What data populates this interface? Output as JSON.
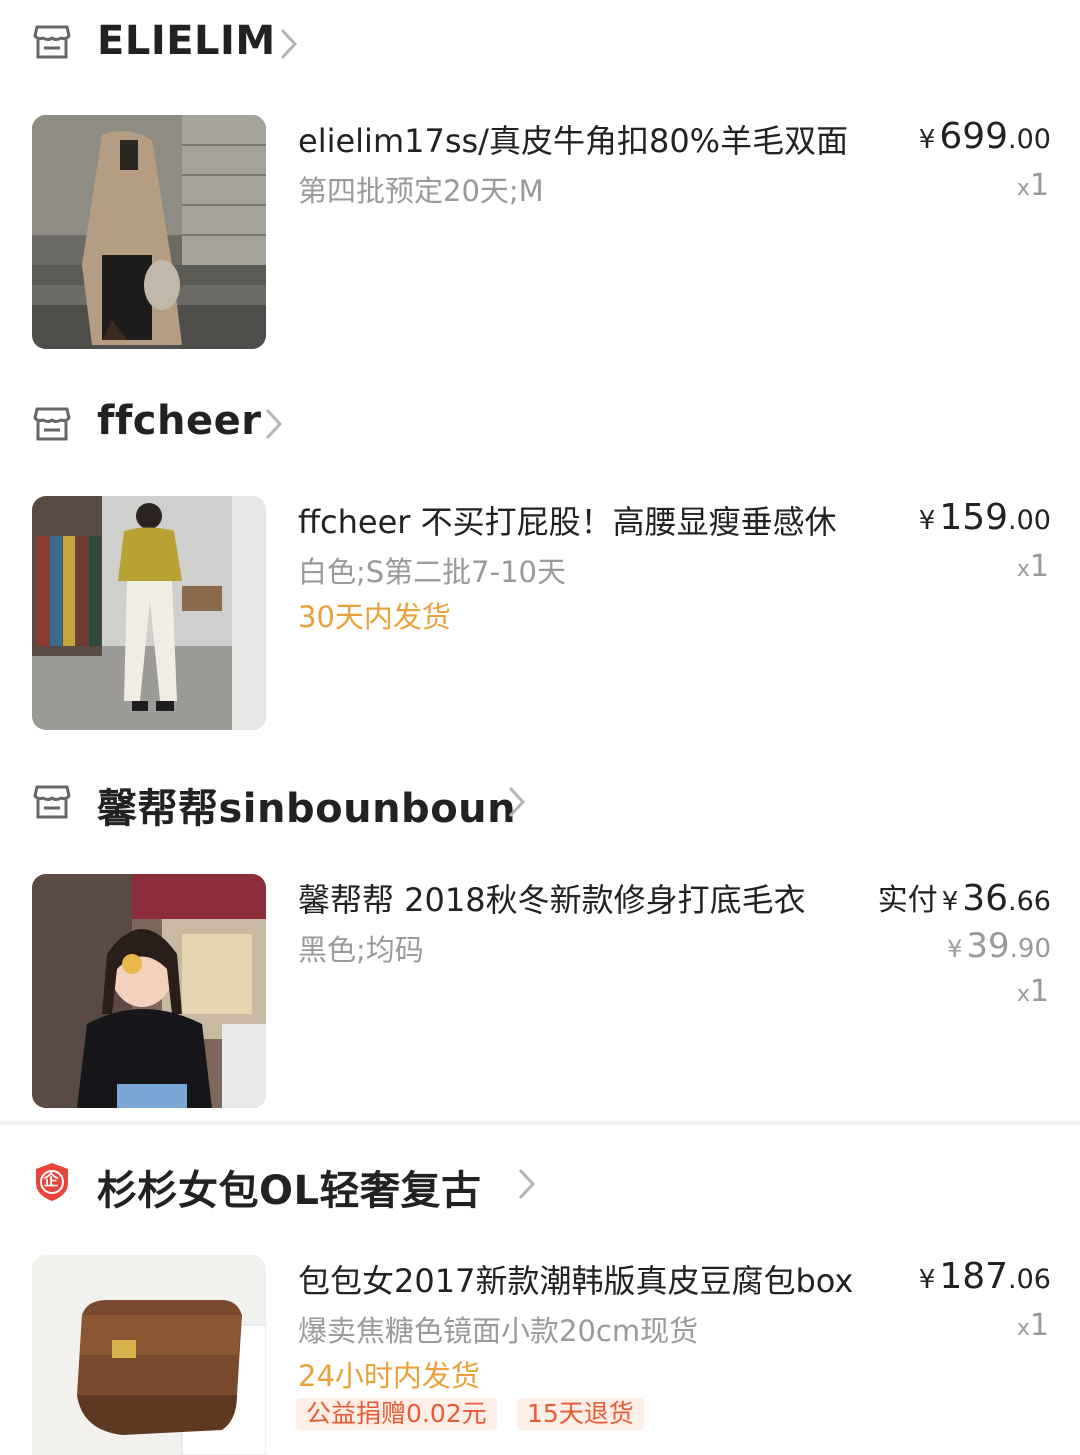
{
  "stores": [
    {
      "name": "ELIELIM",
      "icon": "store-icon",
      "item": {
        "title": "elielim17ss/真皮牛角扣80%羊毛双面",
        "sku": "第四批预定20天;M",
        "currency": "¥",
        "price_int": "699",
        "price_dec": ".00",
        "qty_x": "x",
        "qty": "1"
      }
    },
    {
      "name": "ffcheer",
      "icon": "store-icon",
      "item": {
        "title": "ffcheer 不买打屁股！高腰显瘦垂感休",
        "sku": "白色;S第二批7-10天",
        "ship": "30天内发货",
        "currency": "¥",
        "price_int": "159",
        "price_dec": ".00",
        "qty_x": "x",
        "qty": "1"
      }
    },
    {
      "name": "馨帮帮sinbounboun",
      "icon": "store-icon",
      "item": {
        "title": "馨帮帮 2018秋冬新款修身打底毛衣",
        "sku": "黑色;均码",
        "paid_label": "实付",
        "currency": "¥",
        "price_int": "36",
        "price_dec": ".66",
        "orig_currency": "¥",
        "orig_int": "39",
        "orig_dec": ".90",
        "qty_x": "x",
        "qty": "1"
      }
    },
    {
      "name": "杉杉女包OL轻奢复古",
      "icon": "enterprise-badge-icon",
      "badge_char": "企",
      "item": {
        "title": "包包女2017新款潮韩版真皮豆腐包box",
        "sku": "爆卖焦糖色镜面小款20cm现货",
        "ship": "24小时内发货",
        "tags": [
          "公益捐赠0.02元",
          "15天退货"
        ],
        "currency": "¥",
        "price_int": "187",
        "price_dec": ".06",
        "qty_x": "x",
        "qty": "1"
      }
    }
  ],
  "colors": {
    "ship_orange": "#e9a23b",
    "tag_red": "#ea5b34",
    "tag_bg": "#fdeee8",
    "muted": "#9a9a9a",
    "badge_red": "#e8453c"
  }
}
